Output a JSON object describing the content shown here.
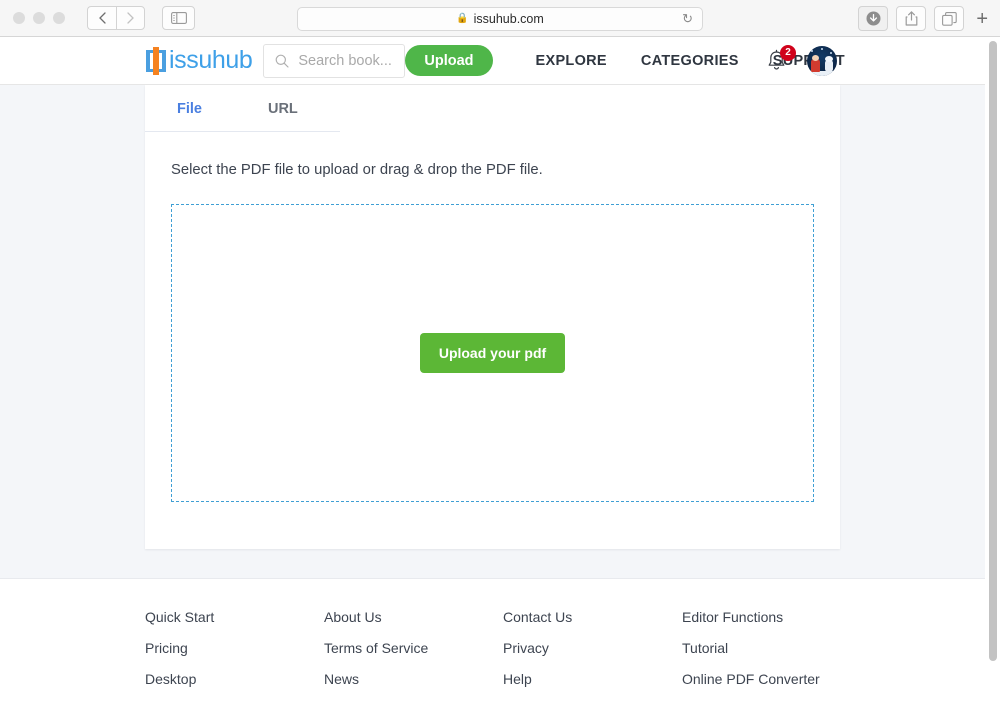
{
  "browser": {
    "url": "issuhub.com",
    "lock_icon": "lock-icon",
    "reload_icon": "reload-icon",
    "back_icon": "chevron-left-icon",
    "forward_icon": "chevron-right-icon",
    "sidebar_icon": "sidebar-toggle-icon",
    "download_icon": "download-icon",
    "share_icon": "share-icon",
    "tabs_icon": "tab-overview-icon",
    "new_tab_label": "+"
  },
  "header": {
    "logo_text": "issuhub",
    "logo_icon": "issuhub-logo-icon",
    "search": {
      "placeholder": "Search book...",
      "value": "",
      "icon": "search-icon"
    },
    "upload_label": "Upload",
    "nav_links": [
      {
        "label": "EXPLORE"
      },
      {
        "label": "CATEGORIES"
      },
      {
        "label": "SUPPORT"
      }
    ],
    "bell_icon": "bell-icon",
    "notification_count": "2",
    "avatar_icon": "user-avatar"
  },
  "main": {
    "tabs": [
      {
        "label": "File",
        "active": true
      },
      {
        "label": "URL",
        "active": false
      }
    ],
    "instruction": "Select the PDF file to upload or drag & drop the PDF file.",
    "upload_button_label": "Upload your pdf"
  },
  "footer": {
    "columns": [
      {
        "links": [
          {
            "label": "Quick Start"
          },
          {
            "label": "Pricing"
          },
          {
            "label": "Desktop"
          }
        ]
      },
      {
        "links": [
          {
            "label": "About Us"
          },
          {
            "label": "Terms of Service"
          },
          {
            "label": "News"
          }
        ]
      },
      {
        "links": [
          {
            "label": "Contact Us"
          },
          {
            "label": "Privacy"
          },
          {
            "label": "Help"
          }
        ]
      },
      {
        "links": [
          {
            "label": "Editor Functions"
          },
          {
            "label": "Tutorial"
          },
          {
            "label": "Online PDF Converter"
          }
        ]
      }
    ]
  },
  "colors": {
    "accent_blue": "#3ea0e8",
    "brand_orange": "#f58220",
    "upload_green": "#4fb649",
    "button_green": "#5cb736",
    "badge_red": "#d0021b",
    "page_bg": "#f4f6f9",
    "dropzone_border": "#3f9fd4",
    "tab_active": "#4a7fe0"
  }
}
